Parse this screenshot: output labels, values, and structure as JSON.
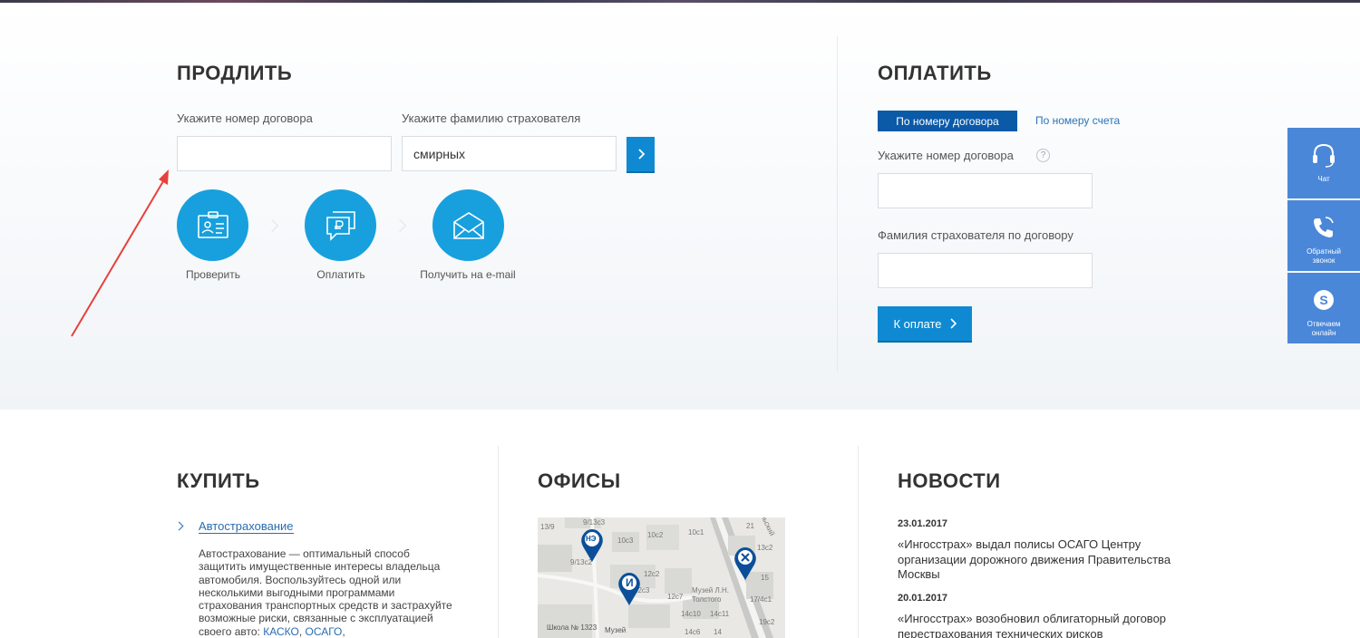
{
  "renew": {
    "title": "ПРОДЛИТЬ",
    "contract_label": "Укажите номер договора",
    "contract_value": "",
    "surname_label": "Укажите фамилию страхователя",
    "surname_value": "смирных",
    "steps": [
      {
        "label": "Проверить",
        "icon": "id-card-icon"
      },
      {
        "label": "Оплатить",
        "icon": "ruble-chat-icon"
      },
      {
        "label": "Получить на e-mail",
        "icon": "envelope-icon"
      }
    ]
  },
  "pay": {
    "title": "ОПЛАТИТЬ",
    "tab_active": "По номеру договора",
    "tab_other": "По номеру счета",
    "contract_label": "Укажите номер договора",
    "help_glyph": "?",
    "surname_label": "Фамилия страхователя по договору",
    "submit_label": "К оплате"
  },
  "sidebar": [
    {
      "label": "Чат",
      "icon": "headset-icon"
    },
    {
      "label": "Обратный звонок",
      "icon": "phone-callback-icon"
    },
    {
      "label": "Отвечаем онлайн",
      "icon": "skype-icon"
    }
  ],
  "buy": {
    "title": "КУПИТЬ",
    "link": "Автострахование",
    "text": "Автострахование — оптимальный способ защитить имущественные интересы владельца автомобиля. Воспользуйтесь одной или несколькими выгодными программами страхования транспортных средств и застрахуйте возможные риски, связанные с эксплуатацией своего авто:",
    "link_kasko": "КАСКО",
    "link_osago": "ОСАГО"
  },
  "offices": {
    "title": "ОФИСЫ",
    "map_labels": [
      "13/9",
      "9/13c3",
      "9/13c2",
      "10c3",
      "10c1",
      "10c2",
      "21",
      "13c2",
      "12c2",
      "12c3",
      "12c7",
      "14c10",
      "14c11",
      "Музей Л.Н. Толстого",
      "17/4c1",
      "15",
      "Школа № 1323",
      "Музей",
      "14c6",
      "14",
      "19c2",
      "ольский"
    ],
    "markers": [
      "НЭ",
      "И"
    ]
  },
  "news": {
    "title": "НОВОСТИ",
    "items": [
      {
        "date": "23.01.2017",
        "text": "«Ингосстрах» выдал полисы ОСАГО Центру организации дорожного движения Правительства Москвы"
      },
      {
        "date": "20.01.2017",
        "text": "«Ингосстрах» возобновил облигаторный договор перестрахования технических рисков"
      }
    ]
  },
  "colors": {
    "accent": "#0f8ad2",
    "circle": "#17a0dd",
    "tab": "#0a5aa8",
    "sidebar": "#4a87d8",
    "annotation_arrow": "#e8403a"
  }
}
